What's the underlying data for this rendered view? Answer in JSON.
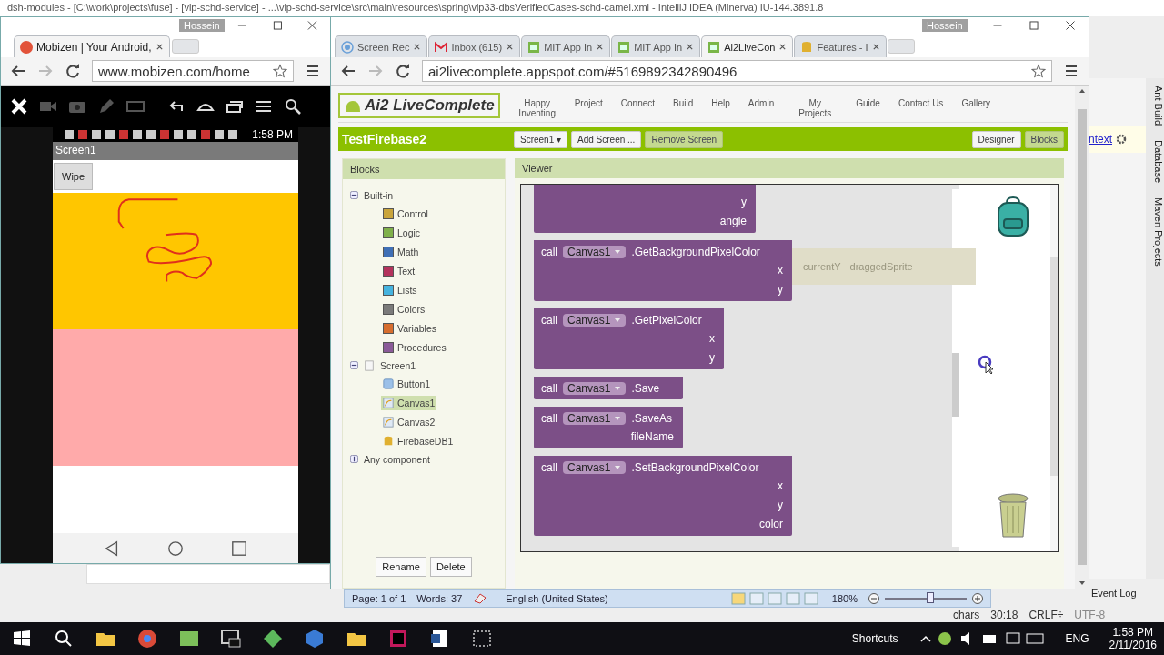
{
  "ide": {
    "title": "dsh-modules - [C:\\work\\projects\\fuse] - [vlp-schd-service] - ...\\vlp-schd-service\\src\\main\\resources\\spring\\vlp33-dbsVerifiedCases-schd-camel.xml - IntelliJ IDEA (Minerva) IU-144.3891.8",
    "side_tabs": [
      "Ant Build",
      "Database",
      "Maven Projects"
    ],
    "context_link": "ntext",
    "event_log": "Event Log",
    "status": [
      "chars",
      "30:18",
      "CRLF÷",
      "UTF-8"
    ]
  },
  "mobizen_window": {
    "user": "Hossein",
    "tab": "Mobizen | Your Android,",
    "url": "www.mobizen.com/home",
    "phone": {
      "time": "1:58 PM",
      "screen_title": "Screen1",
      "button": "Wipe"
    }
  },
  "ai2_window": {
    "user": "Hossein",
    "tabs": [
      {
        "label": "Screen Rec",
        "kind": "record",
        "selected": false
      },
      {
        "label": "Inbox (615)",
        "kind": "mail",
        "selected": false
      },
      {
        "label": "MIT App In",
        "kind": "robot",
        "selected": false
      },
      {
        "label": "MIT App In",
        "kind": "robot",
        "selected": false
      },
      {
        "label": "Ai2LiveCon",
        "kind": "robot",
        "selected": true
      },
      {
        "label": "Features - I",
        "kind": "database",
        "selected": false
      }
    ],
    "url": "ai2livecomplete.appspot.com/#5169892342890496",
    "logo": "Ai2 LiveComplete",
    "tagline": "Happy Inventing",
    "menu": [
      "Project",
      "Connect",
      "Build",
      "Help",
      "Admin",
      "My Projects",
      "Guide",
      "Contact Us",
      "Gallery"
    ],
    "project": "TestFirebase2",
    "screen_select": "Screen1 ▾",
    "add_screen": "Add Screen ...",
    "remove_screen": {
      "label": "Remove Screen",
      "disabled": true
    },
    "modes": [
      {
        "label": "Designer",
        "selected": false
      },
      {
        "label": "Blocks",
        "selected": true
      }
    ],
    "blocks_panel": {
      "title": "Blocks",
      "tree": [
        {
          "label": "Built-in",
          "expanded": true,
          "children": [
            {
              "label": "Control",
              "color": "#c9a43b"
            },
            {
              "label": "Logic",
              "color": "#7fb04a"
            },
            {
              "label": "Math",
              "color": "#3f6fb5"
            },
            {
              "label": "Text",
              "color": "#b3325c"
            },
            {
              "label": "Lists",
              "color": "#45b3df"
            },
            {
              "label": "Colors",
              "color": "#7a7a7a"
            },
            {
              "label": "Variables",
              "color": "#d66d2e"
            },
            {
              "label": "Procedures",
              "color": "#8a5a98"
            }
          ]
        },
        {
          "label": "Screen1",
          "expanded": true,
          "children": [
            {
              "label": "Button1",
              "kind": "button",
              "selected": false
            },
            {
              "label": "Canvas1",
              "kind": "canvas",
              "selected": true
            },
            {
              "label": "Canvas2",
              "kind": "canvas",
              "selected": false
            },
            {
              "label": "FirebaseDB1",
              "kind": "database",
              "selected": false
            }
          ]
        },
        {
          "label": "Any component",
          "expanded": false
        }
      ],
      "rename": "Rename",
      "delete": "Delete"
    },
    "viewer": {
      "title": "Viewer",
      "ghost_texts": [
        "currentY",
        "draggedSprite"
      ],
      "blocks": [
        {
          "sockets": [
            "y",
            "angle"
          ]
        },
        {
          "call": "call",
          "component": "Canvas1",
          "method": ".GetBackgroundPixelColor",
          "sockets": [
            "x",
            "y"
          ]
        },
        {
          "call": "call",
          "component": "Canvas1",
          "method": ".GetPixelColor",
          "sockets": [
            "x",
            "y"
          ]
        },
        {
          "call": "call",
          "component": "Canvas1",
          "method": ".Save"
        },
        {
          "call": "call",
          "component": "Canvas1",
          "method": ".SaveAs",
          "sockets": [
            "fileName"
          ]
        },
        {
          "call": "call",
          "component": "Canvas1",
          "method": ".SetBackgroundPixelColor",
          "sockets": [
            "x",
            "y",
            "color"
          ]
        }
      ]
    }
  },
  "word_status": {
    "page": "Page: 1 of 1",
    "words": "Words: 37",
    "language": "English (United States)",
    "zoom": "180%",
    "zoom_slider": {
      "level": 0.55
    }
  },
  "taskbar": {
    "shortcuts": "Shortcuts",
    "language": "ENG",
    "time": "1:58 PM",
    "date": "2/11/2016"
  }
}
